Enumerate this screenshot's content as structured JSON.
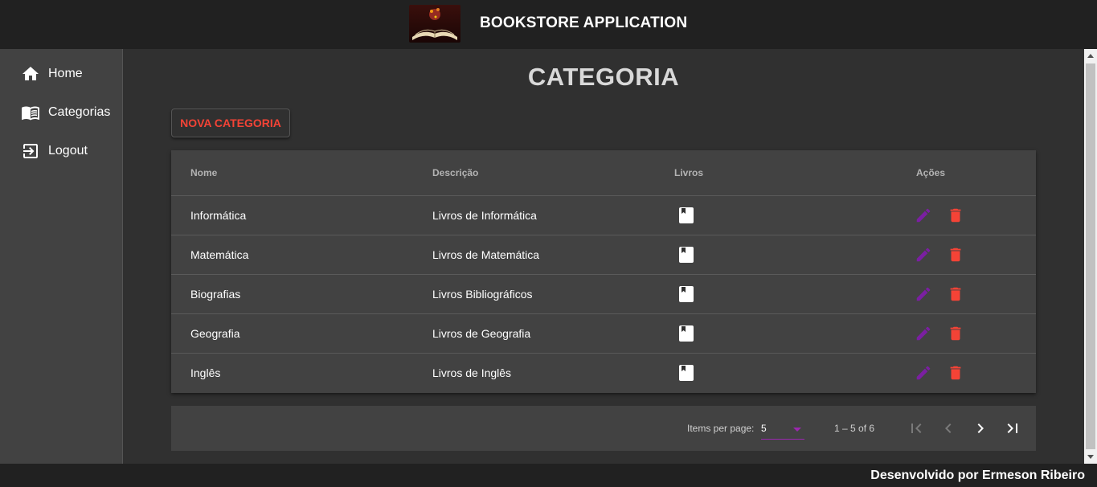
{
  "header": {
    "title": "BOOKSTORE APPLICATION",
    "logo": "book-logo"
  },
  "sidebar": {
    "items": [
      {
        "label": "Home",
        "icon": "home-icon"
      },
      {
        "label": "Categorias",
        "icon": "menu-book-icon"
      },
      {
        "label": "Logout",
        "icon": "logout-icon"
      }
    ]
  },
  "main": {
    "title": "CATEGORIA",
    "new_button": "NOVA CATEGORIA"
  },
  "table": {
    "columns": [
      "Nome",
      "Descrição",
      "Livros",
      "Ações"
    ],
    "rows": [
      {
        "nome": "Informática",
        "descricao": "Livros de Informática"
      },
      {
        "nome": "Matemática",
        "descricao": "Livros de Matemática"
      },
      {
        "nome": "Biografias",
        "descricao": "Livros Bibliográficos"
      },
      {
        "nome": "Geografia",
        "descricao": "Livros de Geografia"
      },
      {
        "nome": "Inglês",
        "descricao": "Livros de Inglês"
      }
    ]
  },
  "paginator": {
    "items_per_page_label": "Items per page:",
    "page_size": "5",
    "range": "1 – 5 of 6"
  },
  "footer": {
    "text": "Desenvolvido por Ermeson Ribeiro"
  },
  "colors": {
    "accent": "#9c27b0",
    "warn": "#f44336",
    "toolbar": "#212121",
    "sidenav": "#424242"
  }
}
